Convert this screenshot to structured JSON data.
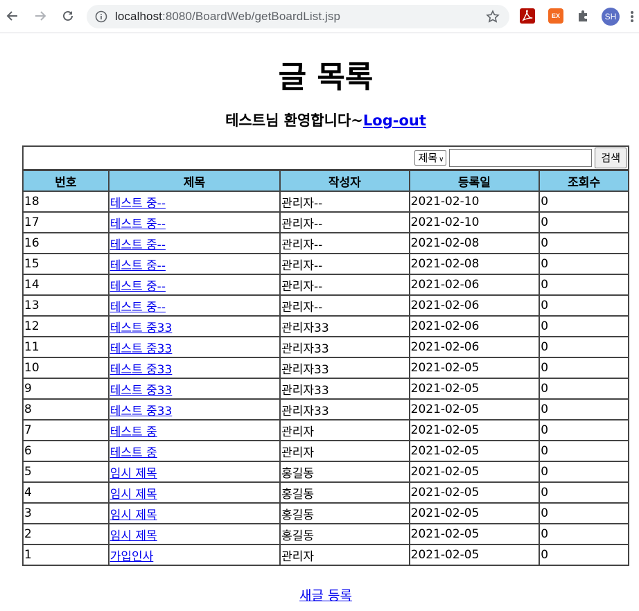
{
  "browser": {
    "url_host": "localhost",
    "url_rest": ":8080/BoardWeb/getBoardList.jsp",
    "ext_ex_label": "EX",
    "avatar_initials": "SH"
  },
  "page": {
    "title": "글 목록",
    "welcome": "테스트님 환영합니다~",
    "logout_label": "Log-out",
    "new_post_label": "새글 등록"
  },
  "search": {
    "condition_selected": "제목",
    "keyword_value": "",
    "button_label": "검색"
  },
  "table": {
    "headers": [
      "번호",
      "제목",
      "작성자",
      "등록일",
      "조회수"
    ],
    "rows": [
      [
        "18",
        "테스트 중--",
        "관리자--",
        "2021-02-10",
        "0"
      ],
      [
        "17",
        "테스트 중--",
        "관리자--",
        "2021-02-10",
        "0"
      ],
      [
        "16",
        "테스트 중--",
        "관리자--",
        "2021-02-08",
        "0"
      ],
      [
        "15",
        "테스트 중--",
        "관리자--",
        "2021-02-08",
        "0"
      ],
      [
        "14",
        "테스트 중--",
        "관리자--",
        "2021-02-06",
        "0"
      ],
      [
        "13",
        "테스트 중--",
        "관리자--",
        "2021-02-06",
        "0"
      ],
      [
        "12",
        "테스트 중33",
        "관리자33",
        "2021-02-06",
        "0"
      ],
      [
        "11",
        "테스트 중33",
        "관리자33",
        "2021-02-06",
        "0"
      ],
      [
        "10",
        "테스트 중33",
        "관리자33",
        "2021-02-05",
        "0"
      ],
      [
        "9",
        "테스트 중33",
        "관리자33",
        "2021-02-05",
        "0"
      ],
      [
        "8",
        "테스트 중33",
        "관리자33",
        "2021-02-05",
        "0"
      ],
      [
        "7",
        "테스트 중",
        "관리자",
        "2021-02-05",
        "0"
      ],
      [
        "6",
        "테스트 중",
        "관리자",
        "2021-02-05",
        "0"
      ],
      [
        "5",
        "임시 제목",
        "홍길동",
        "2021-02-05",
        "0"
      ],
      [
        "4",
        "임시 제목",
        "홍길동",
        "2021-02-05",
        "0"
      ],
      [
        "3",
        "임시 제목",
        "홍길동",
        "2021-02-05",
        "0"
      ],
      [
        "2",
        "임시 제목",
        "홍길동",
        "2021-02-05",
        "0"
      ],
      [
        "1",
        "가입인사",
        "관리자",
        "2021-02-05",
        "0"
      ]
    ]
  },
  "colors": {
    "header_bg": "#87ceeb",
    "link": "#0000ee",
    "border": "#444444"
  }
}
